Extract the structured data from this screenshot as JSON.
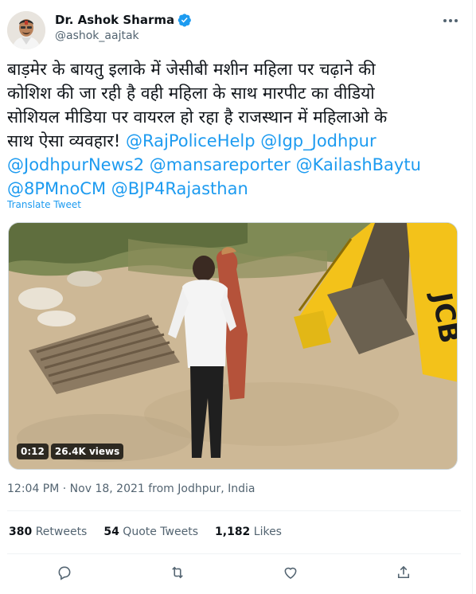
{
  "author": {
    "display_name": "Dr. Ashok Sharma",
    "handle": "@ashok_aajtak",
    "verified": true
  },
  "tweet": {
    "text_lines": [
      "बाड़मेर के बायतु इलाके में जेसीबी मशीन महिला पर चढ़ाने की",
      "कोशिश की जा रही है वही महिला के साथ मारपीट का वीडियो",
      "सोशियल मीडिया पर वायरल हो रहा है राजस्थान में महिलाओ के",
      "साथ ऐसा व्यवहार!"
    ],
    "mentions": [
      "@RajPoliceHelp",
      "@Igp_Jodhpur",
      "@JodhpurNews2",
      "@mansareporter",
      "@KailashBaytu",
      "@8PMnoCM",
      "@BJP4Rajasthan"
    ],
    "translate_label": "Translate Tweet"
  },
  "video": {
    "duration": "0:12",
    "views": "26.4K views",
    "machine_logo_text": "JCB"
  },
  "meta": {
    "timestamp": "12:04 PM · Nov 18, 2021 from Jodhpur, India"
  },
  "stats": {
    "retweets_count": "380",
    "retweets_label": "Retweets",
    "quotes_count": "54",
    "quotes_label": "Quote Tweets",
    "likes_count": "1,182",
    "likes_label": "Likes"
  },
  "icons": {
    "reply": "reply-icon",
    "retweet": "retweet-icon",
    "like": "heart-icon",
    "share": "share-icon",
    "more": "more-icon",
    "verified": "verified-badge-icon"
  },
  "colors": {
    "accent": "#1d9bf0",
    "text_primary": "#0f1419",
    "text_secondary": "#536471",
    "jcb_yellow": "#f3c21a"
  }
}
